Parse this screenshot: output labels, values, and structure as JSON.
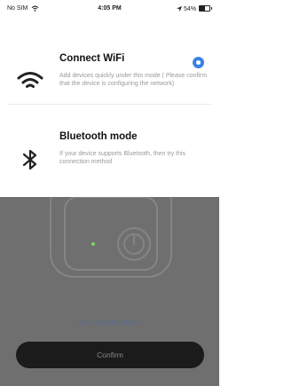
{
  "status_bar": {
    "carrier": "No SIM",
    "time": "4:05 PM",
    "battery": "54%"
  },
  "options": [
    {
      "title": "Connect WiFi",
      "description": "Add devices quickly under this mode ( Please confirm that the device is configuring the network)",
      "icon": "wifi-icon",
      "selected": true
    },
    {
      "title": "Bluetooth mode",
      "description": "If your device supports Bluetooth, then try this connection method",
      "icon": "bluetooth-icon",
      "selected": false
    }
  ],
  "steps_link": "View specific steps ›",
  "confirm_label": "Confirm",
  "colors": {
    "accent": "#3a82e4",
    "overlay": "#6f6f6f",
    "button": "#1b1b1b"
  }
}
